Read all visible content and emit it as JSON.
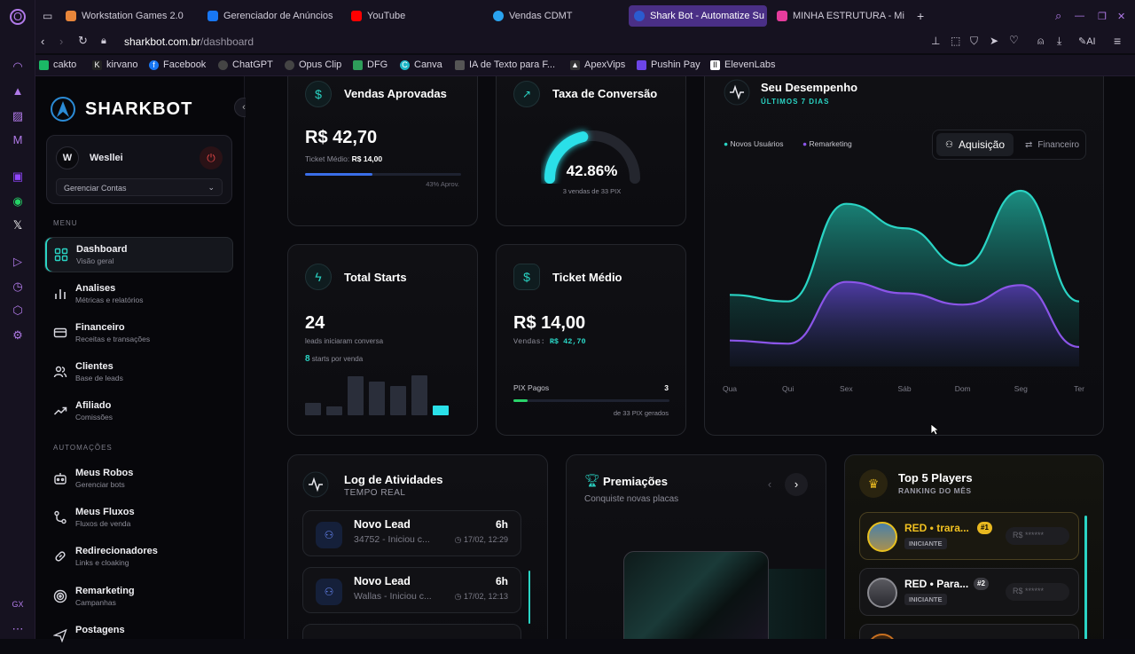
{
  "browser": {
    "tabs": [
      {
        "label": "Workstation Games 2.0",
        "color": "#e8863a"
      },
      {
        "label": "Gerenciador de Anúncios",
        "color": "#1877f2"
      },
      {
        "label": "YouTube",
        "color": "#ff0000"
      },
      {
        "label": "Vendas CDMT",
        "color": "#2aa3ef"
      },
      {
        "label": "Shark Bot - Automatize Su",
        "color": "#2b5bd0"
      },
      {
        "label": "MINHA ESTRUTURA - Min",
        "color": "#e53c9c"
      }
    ],
    "url_host": "sharkbot.com.br",
    "url_path": "/dashboard",
    "ai_label": "AI",
    "bookmarks": [
      {
        "label": "cakto",
        "color": "#1bb866"
      },
      {
        "label": "kirvano",
        "color": "#222"
      },
      {
        "label": "Facebook",
        "color": "#1877f2"
      },
      {
        "label": "ChatGPT",
        "color": "#444"
      },
      {
        "label": "Opus Clip",
        "color": "#444"
      },
      {
        "label": "DFG",
        "color": "#2e9d5a"
      },
      {
        "label": "Canva",
        "color": "#1fb6c8"
      },
      {
        "label": "IA de Texto para F...",
        "color": "#555"
      },
      {
        "label": "ApexVips",
        "color": "#333"
      },
      {
        "label": "Pushin Pay",
        "color": "#6c45e8"
      },
      {
        "label": "ElevenLabs",
        "color": "#fff"
      }
    ]
  },
  "sidebar": {
    "brand": "SHARKBOT",
    "user_initial": "W",
    "user_name": "Weslleі",
    "manage_accounts": "Gerenciar Contas",
    "menu_label": "MENU",
    "automations_label": "AUTOMAÇÕES",
    "menu_items": [
      {
        "label": "Dashboard",
        "sub": "Visão geral",
        "icon": "grid-icon"
      },
      {
        "label": "Analises",
        "sub": "Métricas e relatórios",
        "icon": "bar-chart-icon"
      },
      {
        "label": "Financeiro",
        "sub": "Receitas e transações",
        "icon": "card-icon"
      },
      {
        "label": "Clientes",
        "sub": "Base de leads",
        "icon": "users-icon"
      },
      {
        "label": "Afiliado",
        "sub": "Comissões",
        "icon": "trend-icon"
      }
    ],
    "automation_items": [
      {
        "label": "Meus Robos",
        "sub": "Gerenciar bots",
        "icon": "bot-icon"
      },
      {
        "label": "Meus Fluxos",
        "sub": "Fluxos de venda",
        "icon": "flow-icon"
      },
      {
        "label": "Redirecionadores",
        "sub": "Links e cloaking",
        "icon": "link-icon"
      },
      {
        "label": "Remarketing",
        "sub": "Campanhas",
        "icon": "target-icon"
      },
      {
        "label": "Postagens",
        "sub": "",
        "icon": "send-icon"
      }
    ]
  },
  "sales": {
    "title": "Vendas Aprovadas",
    "value": "R$ 42,70",
    "ticket_label": "Ticket Médio:",
    "ticket_value": "R$ 14,00",
    "approval": "43% Aprov.",
    "progress": 0.43
  },
  "conversion": {
    "title": "Taxa de Conversão",
    "value": "42.86%",
    "sub": "3 vendas de 33 PIX",
    "progress": 0.4286
  },
  "starts": {
    "title": "Total Starts",
    "value": "24",
    "sub": "leads iniciaram conversa",
    "per_sale_num": "8",
    "per_sale_label": "starts por venda",
    "bars": [
      0.3,
      0.22,
      0.95,
      0.82,
      0.72,
      0.98,
      0.24
    ]
  },
  "ticket": {
    "title": "Ticket Médio",
    "value": "R$ 14,00",
    "sales_label": "Vendas:",
    "sales_value": "R$ 42,70",
    "pix_label": "PIX Pagos",
    "pix_value": "3",
    "pix_sub": "de 33 PIX gerados",
    "progress": 0.09
  },
  "performance": {
    "title": "Seu Desempenho",
    "subtitle": "ÚLTIMOS 7 DIAS",
    "tab_active": "Aquisição",
    "tab_other": "Financeiro"
  },
  "chart_data": {
    "type": "area",
    "categories": [
      "Qua",
      "Qui",
      "Sex",
      "Sáb",
      "Dom",
      "Seg",
      "Ter"
    ],
    "series": [
      {
        "name": "Novos Usuários",
        "color": "#2ad4c4",
        "values": [
          44,
          40,
          100,
          85,
          62,
          108,
          40
        ]
      },
      {
        "name": "Remarketing",
        "color": "#8b55e8",
        "values": [
          16,
          14,
          52,
          45,
          38,
          50,
          12
        ]
      }
    ],
    "ylim": [
      0,
      120
    ]
  },
  "log": {
    "title": "Log de Atividades",
    "subtitle": "TEMPO REAL",
    "items": [
      {
        "title": "Novo Lead",
        "time": "6h",
        "desc": "34752 - Iniciou c...",
        "when": "17/02, 12:29"
      },
      {
        "title": "Novo Lead",
        "time": "6h",
        "desc": "Wallas - Iniciou c...",
        "when": "17/02, 12:13"
      }
    ]
  },
  "awards": {
    "title": "Premiações",
    "subtitle": "Conquiste novas placas"
  },
  "top": {
    "title": "Top 5 Players",
    "subtitle": "RANKING DO MÊS",
    "players": [
      {
        "name": "RED • trara...",
        "rank": "#1",
        "badge": "INICIANTE",
        "value": "R$ ******"
      },
      {
        "name": "RED • Para...",
        "rank": "#2",
        "badge": "INICIANTE",
        "value": "R$ ******"
      }
    ]
  }
}
